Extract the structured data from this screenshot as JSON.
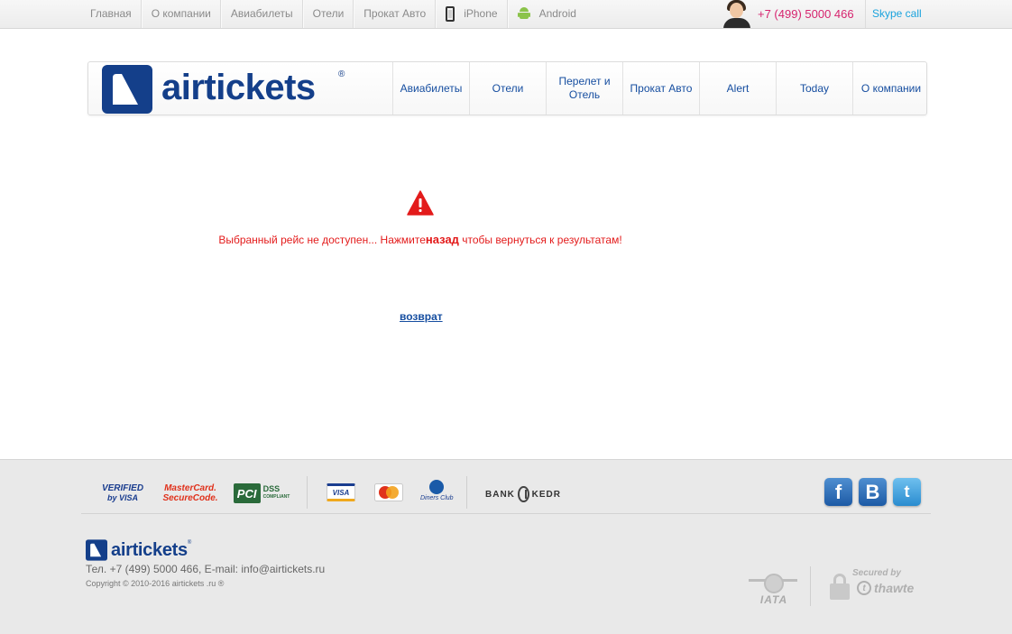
{
  "topbar": {
    "nav": [
      "Главная",
      "О компании",
      "Авиабилеты",
      "Отели",
      "Прокат Авто",
      "iPhone",
      "Android"
    ],
    "phone": "+7 (499) 5000 466",
    "skype": "Skype call"
  },
  "header": {
    "logo_text": "airtickets",
    "logo_reg": "®",
    "nav": [
      "Авиабилеты",
      "Отели",
      "Перелет и Отель",
      "Прокат Авто",
      "Alert",
      "Today",
      "О компании"
    ]
  },
  "error": {
    "message_before": "Выбранный рейс не доступен... Нажмите",
    "message_bold": "назад",
    "message_after": " чтобы вернуться к результатам!",
    "back_link": "возврат"
  },
  "footer": {
    "badges": {
      "verified_line1": "VERIFIED",
      "verified_line2": "by VISA",
      "mc_line1": "MasterCard.",
      "mc_line2": "SecureCode.",
      "pci": "PCI",
      "dss": "DSS",
      "dss_sub": "COMPLIANT",
      "visa": "VISA",
      "diners": "Diners Club",
      "bank_left": "BANK",
      "bank_right": "KEDR"
    },
    "social": {
      "facebook": "f",
      "vk": "B",
      "twitter": "t"
    },
    "logo_text": "airtickets",
    "logo_reg": "®",
    "contact": "Тел. +7 (499) 5000 466, E-mail:  info@airtickets.ru",
    "copyright": "Copyright © 2010-2016 airtickets .ru ®",
    "iata": "IATA",
    "secured_by": "Secured by",
    "thawte": "thawte"
  },
  "colors": {
    "brand_blue": "#143f8a",
    "nav_blue": "#164ea0",
    "error_red": "#e31b1b",
    "phone_pink": "#d6246e",
    "skype_blue": "#1aa3dd"
  }
}
